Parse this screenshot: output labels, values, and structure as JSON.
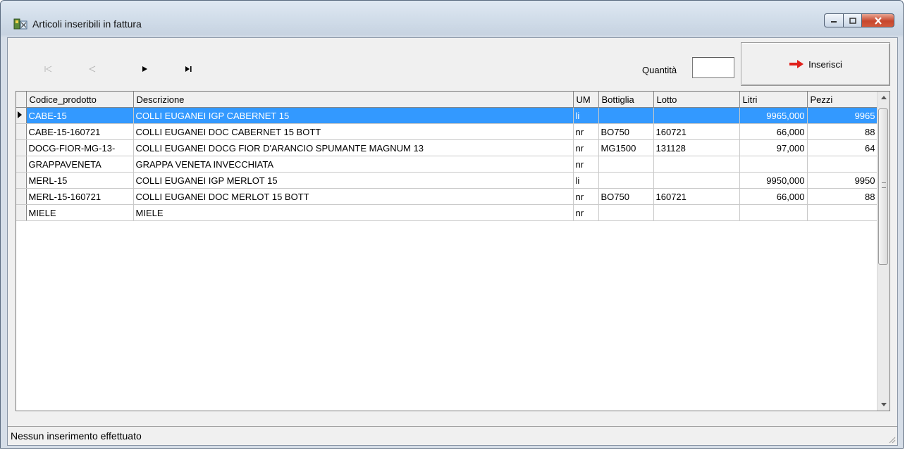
{
  "window": {
    "title": "Articoli inseribili in fattura"
  },
  "toolbar": {
    "first": "|◁",
    "prev": "◁",
    "next": "▶",
    "last": "▶|",
    "quantity_label": "Quantità",
    "quantity_value": "",
    "insert_label": "Inserisci"
  },
  "grid": {
    "columns": [
      "Codice_prodotto",
      "Descrizione",
      "UM",
      "Bottiglia",
      "Lotto",
      "Litri",
      "Pezzi"
    ],
    "rows": [
      {
        "codice": "CABE-15",
        "descrizione": "COLLI EUGANEI IGP CABERNET 15",
        "um": "li",
        "bottiglia": "",
        "lotto": "",
        "litri": "9965,000",
        "pezzi": "9965",
        "selected": true
      },
      {
        "codice": "CABE-15-160721",
        "descrizione": "COLLI EUGANEI DOC CABERNET 15 BOTT",
        "um": "nr",
        "bottiglia": "BO750",
        "lotto": "160721",
        "litri": "66,000",
        "pezzi": "88"
      },
      {
        "codice": "DOCG-FIOR-MG-13-",
        "descrizione": "COLLI EUGANEI DOCG FIOR D'ARANCIO SPUMANTE MAGNUM 13",
        "um": "nr",
        "bottiglia": "MG1500",
        "lotto": "131128",
        "litri": "97,000",
        "pezzi": "64"
      },
      {
        "codice": "GRAPPAVENETA",
        "descrizione": "GRAPPA VENETA INVECCHIATA",
        "um": "nr",
        "bottiglia": "",
        "lotto": "",
        "litri": "",
        "pezzi": ""
      },
      {
        "codice": "MERL-15",
        "descrizione": "COLLI EUGANEI IGP MERLOT 15",
        "um": "li",
        "bottiglia": "",
        "lotto": "",
        "litri": "9950,000",
        "pezzi": "9950"
      },
      {
        "codice": "MERL-15-160721",
        "descrizione": "COLLI EUGANEI DOC MERLOT 15 BOTT",
        "um": "nr",
        "bottiglia": "BO750",
        "lotto": "160721",
        "litri": "66,000",
        "pezzi": "88"
      },
      {
        "codice": "MIELE",
        "descrizione": "MIELE",
        "um": "nr",
        "bottiglia": "",
        "lotto": "",
        "litri": "",
        "pezzi": ""
      }
    ]
  },
  "status": {
    "text": "Nessun inserimento effettuato"
  },
  "colors": {
    "selection": "#3399ff",
    "arrow": "#e0201a"
  }
}
